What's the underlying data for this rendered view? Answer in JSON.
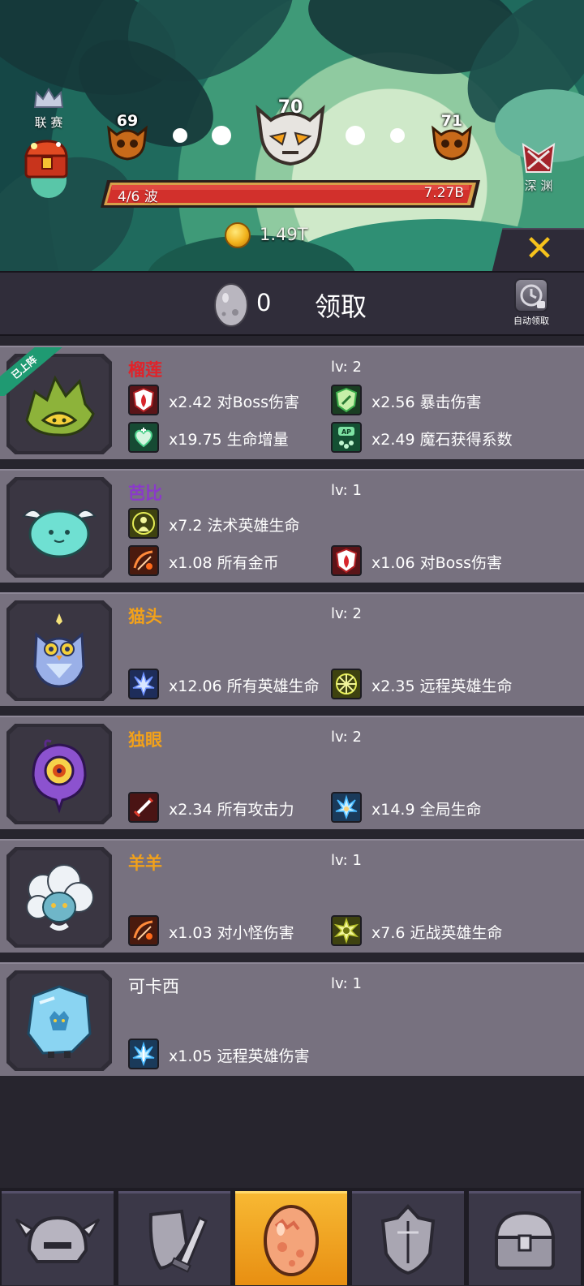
{
  "stage": {
    "prev_level": "69",
    "current_level": "70",
    "next_level": "71",
    "wave_text": "4/6 波",
    "boss_hp": "7.27B",
    "gold": "1.49T"
  },
  "side": {
    "league_label": "联 赛",
    "abyss_label": "深 渊"
  },
  "header": {
    "egg_count": "0",
    "claim_label": "领取",
    "auto_claim_label": "自动领取"
  },
  "pets": [
    {
      "name": "榴莲",
      "name_color": "#e0232a",
      "level": "lv: 2",
      "badge": "已上阵",
      "stats": [
        {
          "icon": "boss-damage-icon",
          "text": "x2.42 对Boss伤害"
        },
        {
          "icon": "crit-damage-icon",
          "text": "x2.56 暴击伤害"
        },
        {
          "icon": "health-gain-icon",
          "text": "x19.75 生命增量"
        },
        {
          "icon": "magic-stone-icon",
          "text": "x2.49 魔石获得系数"
        }
      ]
    },
    {
      "name": "芭比",
      "name_color": "#8a3ac9",
      "level": "lv: 1",
      "stats": [
        {
          "icon": "mage-hp-icon",
          "text": "x7.2 法术英雄生命"
        },
        {
          "icon": "all-gold-icon",
          "text": "x1.08 所有金币"
        },
        {
          "icon": "boss-damage-icon",
          "text": "x1.06 对Boss伤害"
        }
      ]
    },
    {
      "name": "猫头",
      "name_color": "#f2a11a",
      "level": "lv: 2",
      "stats": [
        {
          "icon": "all-hero-hp-icon",
          "text": "x12.06 所有英雄生命"
        },
        {
          "icon": "ranged-hp-icon",
          "text": "x2.35 远程英雄生命"
        }
      ]
    },
    {
      "name": "独眼",
      "name_color": "#f2a11a",
      "level": "lv: 2",
      "stats": [
        {
          "icon": "attack-icon",
          "text": "x2.34 所有攻击力"
        },
        {
          "icon": "global-hp-icon",
          "text": "x14.9 全局生命"
        }
      ]
    },
    {
      "name": "羊羊",
      "name_color": "#f2a11a",
      "level": "lv: 1",
      "stats": [
        {
          "icon": "minion-damage-icon",
          "text": "x1.03 对小怪伤害"
        },
        {
          "icon": "melee-hp-icon",
          "text": "x7.6 近战英雄生命"
        }
      ]
    },
    {
      "name": "可卡西",
      "name_color": "#ffffff",
      "level": "lv: 1",
      "stats": [
        {
          "icon": "ranged-damage-icon",
          "text": "x1.05 远程英雄伤害"
        }
      ]
    }
  ],
  "tabs": [
    {
      "icon": "helmet-icon",
      "active": false
    },
    {
      "icon": "shield-sword-icon",
      "active": false
    },
    {
      "icon": "egg-icon",
      "active": true
    },
    {
      "icon": "armor-icon",
      "active": false
    },
    {
      "icon": "treasure-chest-icon",
      "active": false
    }
  ]
}
